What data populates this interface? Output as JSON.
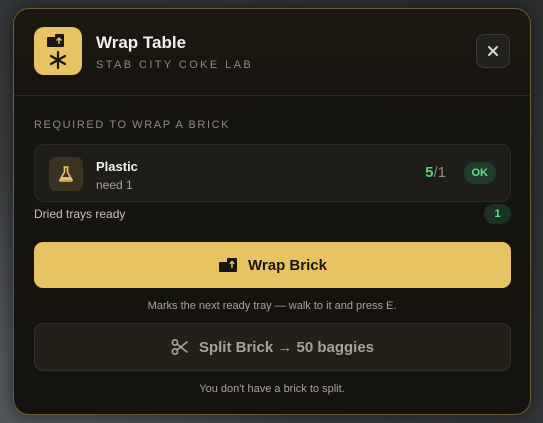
{
  "header": {
    "title": "Wrap Table",
    "subtitle": "STAB CITY COKE LAB",
    "icon": "wrap-table-icon",
    "close_icon": "close-icon"
  },
  "requirements": {
    "section_label": "REQUIRED TO WRAP A BRICK",
    "items": [
      {
        "name": "Plastic",
        "need_text": "need 1",
        "have": "5",
        "need": "1",
        "status": "OK",
        "icon": "flask-icon"
      }
    ]
  },
  "dried_trays": {
    "label": "Dried trays ready",
    "count": "1"
  },
  "actions": {
    "wrap": {
      "label": "Wrap Brick",
      "icon": "package-icon",
      "hint": "Marks the next ready tray — walk to it and press E."
    },
    "split": {
      "label": "Split Brick → 50 baggies",
      "icon": "scissors-icon",
      "hint": "You don't have a brick to split."
    }
  },
  "colors": {
    "accent": "#e7c363",
    "ok": "#5ee08a",
    "panel_bg": "#17140f",
    "border": "#6b5a34"
  }
}
